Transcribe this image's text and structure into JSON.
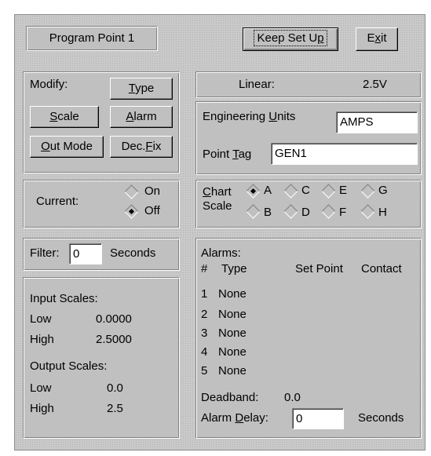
{
  "header": {
    "program_point": "Program Point 1",
    "keep_setup_pre": "Keep Set U",
    "keep_setup_u": "p",
    "keep_setup_post": "",
    "exit_pre": "E",
    "exit_u": "x",
    "exit_post": "it"
  },
  "modify": {
    "label": "Modify:",
    "type_u": "T",
    "type_post": "ype",
    "scale_u": "S",
    "scale_post": "cale",
    "alarm_u": "A",
    "alarm_post": "larm",
    "outmode_u": "O",
    "outmode_post": "ut Mode",
    "decfix_pre": "Dec.",
    "decfix_u": "F",
    "decfix_post": "ix"
  },
  "linear": {
    "label": "Linear:",
    "value": "2.5V"
  },
  "units": {
    "label_pre": "Engineering ",
    "label_u": "U",
    "label_post": "nits",
    "value": "AMPS",
    "tag_pre": "Point ",
    "tag_u": "T",
    "tag_post": "ag",
    "tag_value": "GEN1"
  },
  "current": {
    "label": "Current:",
    "on": "On",
    "off": "Off",
    "selected": "Off"
  },
  "chart_scale": {
    "label1_u": "C",
    "label1_post": "hart",
    "label2": "Scale",
    "options": [
      "A",
      "B",
      "C",
      "D",
      "E",
      "F",
      "G",
      "H"
    ],
    "selected": "A"
  },
  "filter": {
    "label": "Filter:",
    "value": "0",
    "unit": "Seconds"
  },
  "scales": {
    "input_title": "Input Scales:",
    "input_low_label": "Low",
    "input_low": "0.0000",
    "input_high_label": "High",
    "input_high": "2.5000",
    "output_title": "Output Scales:",
    "output_low_label": "Low",
    "output_low": "0.0",
    "output_high_label": "High",
    "output_high": "2.5"
  },
  "alarms": {
    "title": "Alarms:",
    "col_num": "#",
    "col_type": "Type",
    "col_setpoint": "Set Point",
    "col_contact": "Contact",
    "rows": [
      {
        "num": "1",
        "type": "None"
      },
      {
        "num": "2",
        "type": "None"
      },
      {
        "num": "3",
        "type": "None"
      },
      {
        "num": "4",
        "type": "None"
      },
      {
        "num": "5",
        "type": "None"
      }
    ],
    "deadband_label": "Deadband:",
    "deadband_value": "0.0",
    "delay_pre": "Alarm ",
    "delay_u": "D",
    "delay_post": "elay:",
    "delay_value": "0",
    "delay_unit": "Seconds"
  }
}
